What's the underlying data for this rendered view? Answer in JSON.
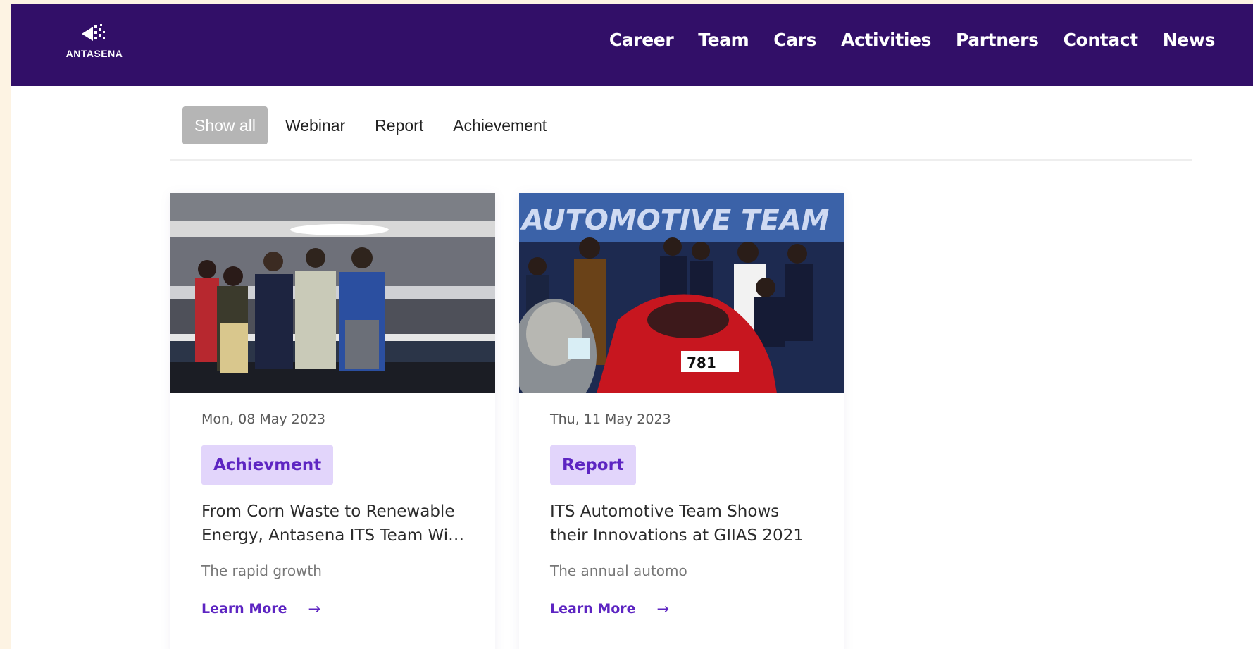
{
  "brand": {
    "logo_text": "ANTASENA",
    "logo_icon": "antasena-logo-icon"
  },
  "nav": {
    "items": [
      {
        "label": "Career"
      },
      {
        "label": "Team"
      },
      {
        "label": "Cars"
      },
      {
        "label": "Activities"
      },
      {
        "label": "Partners"
      },
      {
        "label": "Contact"
      },
      {
        "label": "News"
      }
    ]
  },
  "filters": {
    "items": [
      {
        "label": "Show all",
        "active": true
      },
      {
        "label": "Webinar",
        "active": false
      },
      {
        "label": "Report",
        "active": false
      },
      {
        "label": "Achievement",
        "active": false
      }
    ]
  },
  "cards": [
    {
      "image": "team-photo-group-standing",
      "date": "Mon, 08 May 2023",
      "tag": "Achievment",
      "title_line1": "From Corn Waste to Renewable",
      "title_line2": "Energy, Antasena ITS Team Win...",
      "excerpt": "The rapid growth",
      "link": "Learn More"
    },
    {
      "image": "automotive-team-with-red-car",
      "date": "Thu, 11 May 2023",
      "tag": "Report",
      "title_line1": "ITS Automotive Team Shows",
      "title_line2": "their Innovations at GIIAS 2021",
      "excerpt": "The annual automo",
      "link": "Learn More",
      "banner_text": "AUTOMOTIVE TEAM",
      "car_number": "781"
    }
  ],
  "colors": {
    "header_bg": "#320f68",
    "tag_bg": "#e2d5fb",
    "accent": "#5d25c2",
    "outer_bg": "#fdf3e3"
  }
}
